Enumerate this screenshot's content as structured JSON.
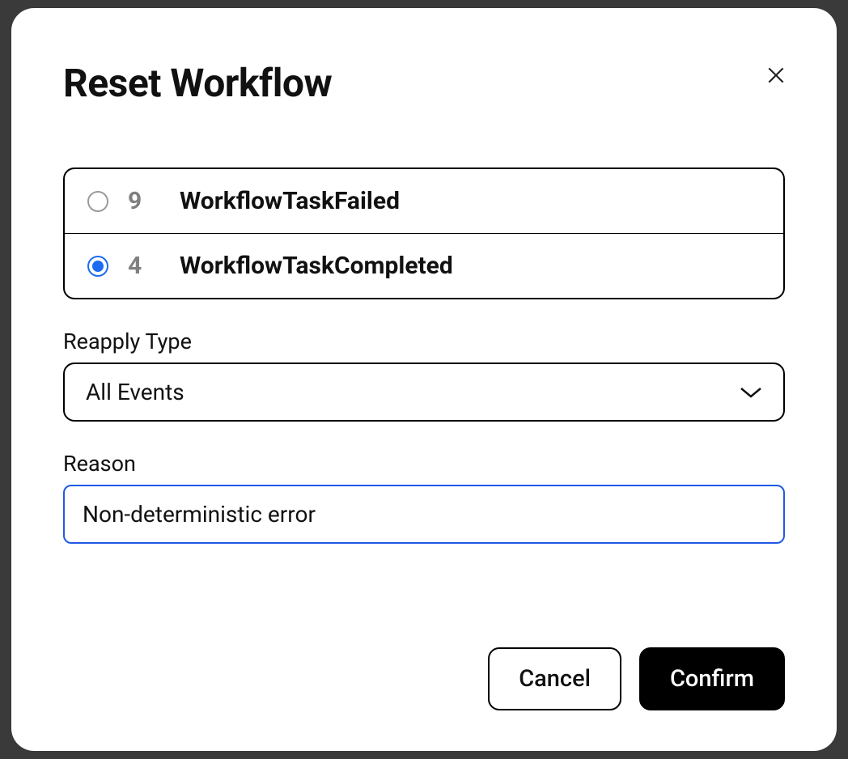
{
  "modal": {
    "title": "Reset Workflow",
    "options": [
      {
        "id": "9",
        "label": "WorkflowTaskFailed",
        "selected": false
      },
      {
        "id": "4",
        "label": "WorkflowTaskCompleted",
        "selected": true
      }
    ],
    "reapply": {
      "label": "Reapply Type",
      "value": "All Events"
    },
    "reason": {
      "label": "Reason",
      "value": "Non-deterministic error"
    },
    "buttons": {
      "cancel": "Cancel",
      "confirm": "Confirm"
    }
  }
}
